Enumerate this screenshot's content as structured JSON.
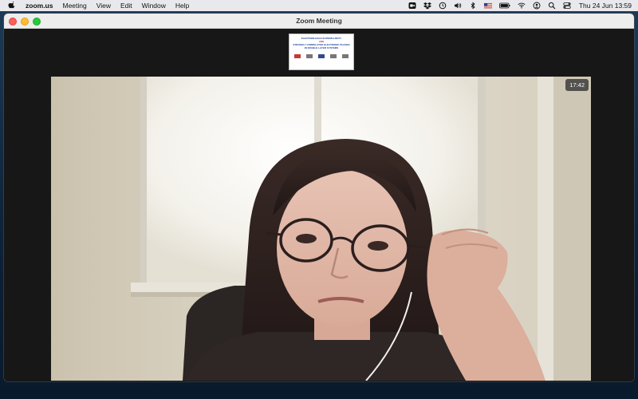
{
  "menubar": {
    "app_name": "zoom.us",
    "items": [
      "Meeting",
      "View",
      "Edit",
      "Window",
      "Help"
    ],
    "clock": "Thu 24 Jun  13:59"
  },
  "window": {
    "title": "Zoom Meeting"
  },
  "shared_screen": {
    "line1": "ELECTRON-HOLE SUPERFLUIDITY",
    "line2": "AND",
    "line3": "STRONGLY CORRELATED ELECTRONIC PHASES",
    "line4": "IN DOUBLE LAYER SYSTEMS"
  },
  "video": {
    "timer": "17:42"
  },
  "colors": {
    "close": "#fe5f57",
    "minimize": "#febc2e",
    "maximize": "#28c840"
  }
}
